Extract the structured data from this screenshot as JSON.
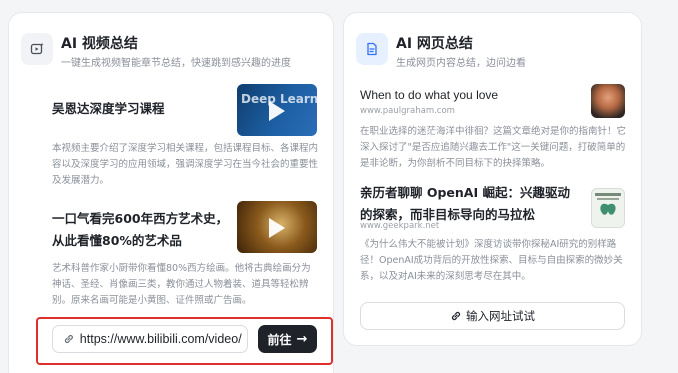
{
  "video_card": {
    "title": "AI 视频总结",
    "subtitle": "一键生成视频智能章节总结，快速跳到感兴趣的进度",
    "icon": "video-sparkle-icon",
    "items": [
      {
        "title": "吴恩达深度学习课程",
        "thumb_text": "Deep Learn",
        "desc": "本视频主要介绍了深度学习相关课程，包括课程目标、各课程内容以及深度学习的应用领域，强调深度学习在当今社会的重要性及发展潜力。"
      },
      {
        "title": "一口气看完600年西方艺术史，从此看懂80%的艺术品",
        "desc": "艺术科普作家小厨带你看懂80%西方绘画。他将古典绘画分为神话、圣经、肖像画三类，教你通过人物着装、道具等轻松辨别。原来名画可能是小黄图、证件照或广告画。"
      }
    ],
    "url_input": {
      "value": "https://www.bilibili.com/video/",
      "placeholder": "https://www.bilibili.com/video/"
    },
    "go_label": "前往"
  },
  "web_card": {
    "title": "AI 网页总结",
    "subtitle": "生成网页内容总结，边问边看",
    "icon": "document-icon",
    "items": [
      {
        "title": "When to do what you love",
        "site": "www.paulgraham.com",
        "desc": "在职业选择的迷茫海洋中徘徊？这篇文章绝对是你的指南针！它深入探讨了\"是否应追随兴趣去工作\"这一关键问题，打破简单的是非论断，为你剖析不同目标下的抉择策略。"
      },
      {
        "title": "亲历者聊聊 OpenAI 崛起：兴趣驱动的探索，而非目标导向的马拉松",
        "site": "www.geekpark.net",
        "desc": "《为什么伟大不能被计划》深度访谈带你探秘AI研究的别样路径！OpenAI成功背后的开放性探索、目标与自由探索的微妙关系，以及对AI未来的深刻思考尽在其中。"
      }
    ],
    "try_label": "输入网址试试"
  },
  "colors": {
    "accent_dark": "#1f2329",
    "highlight_red": "#e0302b",
    "muted_text": "#8a8f99",
    "card_bg": "#ffffff",
    "page_bg": "#f4f5f7"
  }
}
